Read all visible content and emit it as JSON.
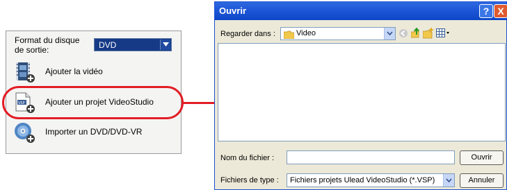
{
  "left_panel": {
    "format_label_line1": "Format du disque",
    "format_label_line2": "de sortie:",
    "format_value": "DVD",
    "actions": [
      {
        "label": "Ajouter la vidéo",
        "icon": "film-strip-icon"
      },
      {
        "label": "Ajouter un projet VideoStudio",
        "icon": "vsp-project-icon"
      },
      {
        "label": "Importer un DVD/DVD-VR",
        "icon": "dvd-disc-icon"
      }
    ]
  },
  "dialog": {
    "title": "Ouvrir",
    "help_glyph": "?",
    "close_glyph": "X",
    "look_in_label": "Regarder dans :",
    "look_in_value": "Video",
    "file_name_label": "Nom du fichier :",
    "file_name_value": "",
    "open_button": "Ouvrir",
    "file_type_label": "Fichiers de type :",
    "file_type_value": "Fichiers projets Ulead VideoStudio (*.VSP)",
    "cancel_button": "Annuler"
  },
  "colors": {
    "highlight": "#e31d25",
    "titlebar": "#0c46c6",
    "select_bg": "#163a86"
  }
}
